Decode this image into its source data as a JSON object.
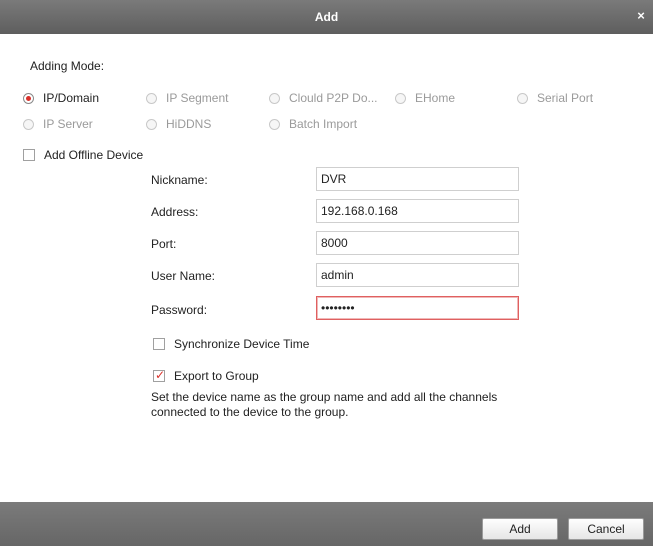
{
  "dialog": {
    "title": "Add",
    "close": "×"
  },
  "adding_mode": {
    "label": "Adding Mode:",
    "options": [
      "IP/Domain",
      "IP Segment",
      "Clould P2P Do...",
      "EHome",
      "Serial Port",
      "IP Server",
      "HiDDNS",
      "Batch Import"
    ],
    "selected": "IP/Domain"
  },
  "offline": {
    "label": "Add Offline Device",
    "checked": false
  },
  "form": {
    "nickname_label": "Nickname:",
    "nickname_value": "DVR",
    "address_label": "Address:",
    "address_value": "192.168.0.168",
    "port_label": "Port:",
    "port_value": "8000",
    "username_label": "User Name:",
    "username_value": "admin",
    "password_label": "Password:",
    "password_value": "••••••••"
  },
  "sync_time": {
    "label": "Synchronize Device Time",
    "checked": false
  },
  "export_group": {
    "label": "Export to Group",
    "checked": true,
    "hint": "Set the device name as the group name and add all the channels connected to the device to the group."
  },
  "footer": {
    "add_label": "Add",
    "cancel_label": "Cancel"
  },
  "colors": {
    "accent": "#d9302a",
    "titlebar": "#6b6b6b"
  }
}
